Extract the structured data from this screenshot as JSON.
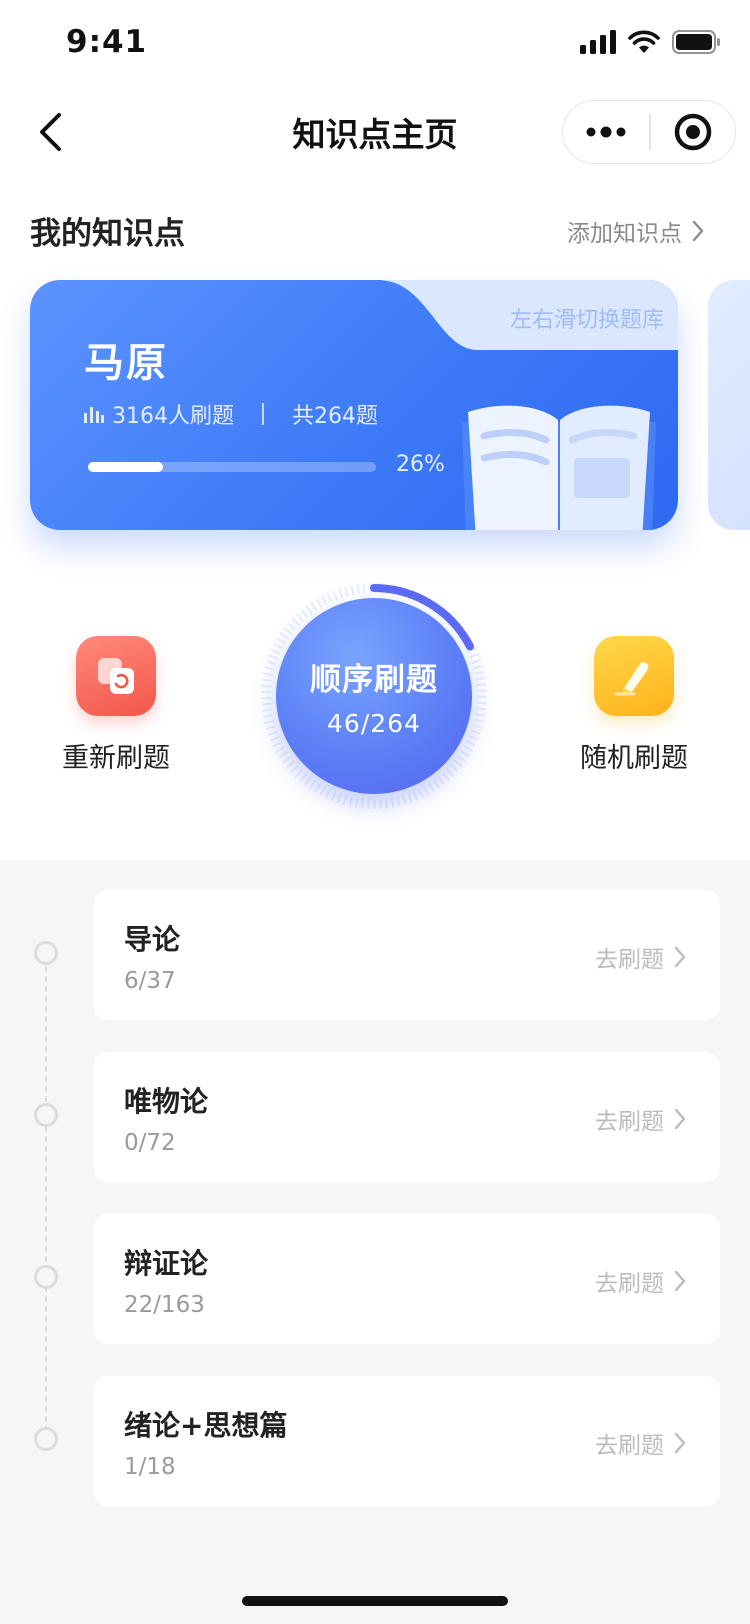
{
  "status_bar": {
    "time": "9:41"
  },
  "nav": {
    "title": "知识点主页"
  },
  "section": {
    "title": "我的知识点",
    "add_label": "添加知识点"
  },
  "card": {
    "title": "马原",
    "swipe_hint": "左右滑切换题库",
    "learners": "3164人刷题",
    "total": "共264题",
    "progress_text": "26%",
    "progress_value": 0.26
  },
  "actions": {
    "restart_label": "重新刷题",
    "random_label": "随机刷题",
    "sequential_label": "顺序刷题",
    "sequential_count": "46/264",
    "sequential_value": 0.174
  },
  "chapters": [
    {
      "name": "导论",
      "progress": "6/37",
      "action": "去刷题"
    },
    {
      "name": "唯物论",
      "progress": "0/72",
      "action": "去刷题"
    },
    {
      "name": "辩证论",
      "progress": "22/163",
      "action": "去刷题"
    },
    {
      "name": "绪论+思想篇",
      "progress": "1/18",
      "action": "去刷题"
    }
  ],
  "colors": {
    "brand_blue": "#3d7af7",
    "restart_red": "#f2564a",
    "random_yellow": "#ffb21a",
    "dial_blue": "#5c7ff6"
  }
}
